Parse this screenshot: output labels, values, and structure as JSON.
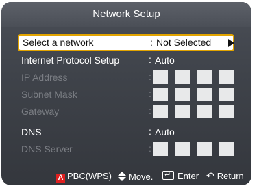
{
  "window": {
    "title": "Network Setup"
  },
  "rows": [
    {
      "label": "Select a network",
      "colon": ":",
      "value": "Not Selected"
    },
    {
      "label": "Internet Protocol Setup",
      "colon": ":",
      "value": "Auto"
    },
    {
      "label": "IP Address",
      "colon": ":"
    },
    {
      "label": "Subnet Mask",
      "colon": ":"
    },
    {
      "label": "Gateway",
      "colon": ":"
    },
    {
      "label": "DNS",
      "colon": ":",
      "value": "Auto"
    },
    {
      "label": "DNS Server",
      "colon": ":"
    }
  ],
  "footer": {
    "a_button": "A",
    "pbc": "PBC(WPS)",
    "move": "Move.",
    "enter": "Enter",
    "return": "Return"
  },
  "icons": {
    "a_button": "red-a-button-icon",
    "move": "up-down-arrows-icon",
    "enter": "enter-icon",
    "return": "return-icon",
    "select_arrow": "right-arrow-icon"
  },
  "colors": {
    "panel_bg": "#3f434a",
    "selected_bg": "#ffffff",
    "selected_border": "#e2a400",
    "disabled_text": "#7a7d83",
    "a_button": "#e02020"
  }
}
